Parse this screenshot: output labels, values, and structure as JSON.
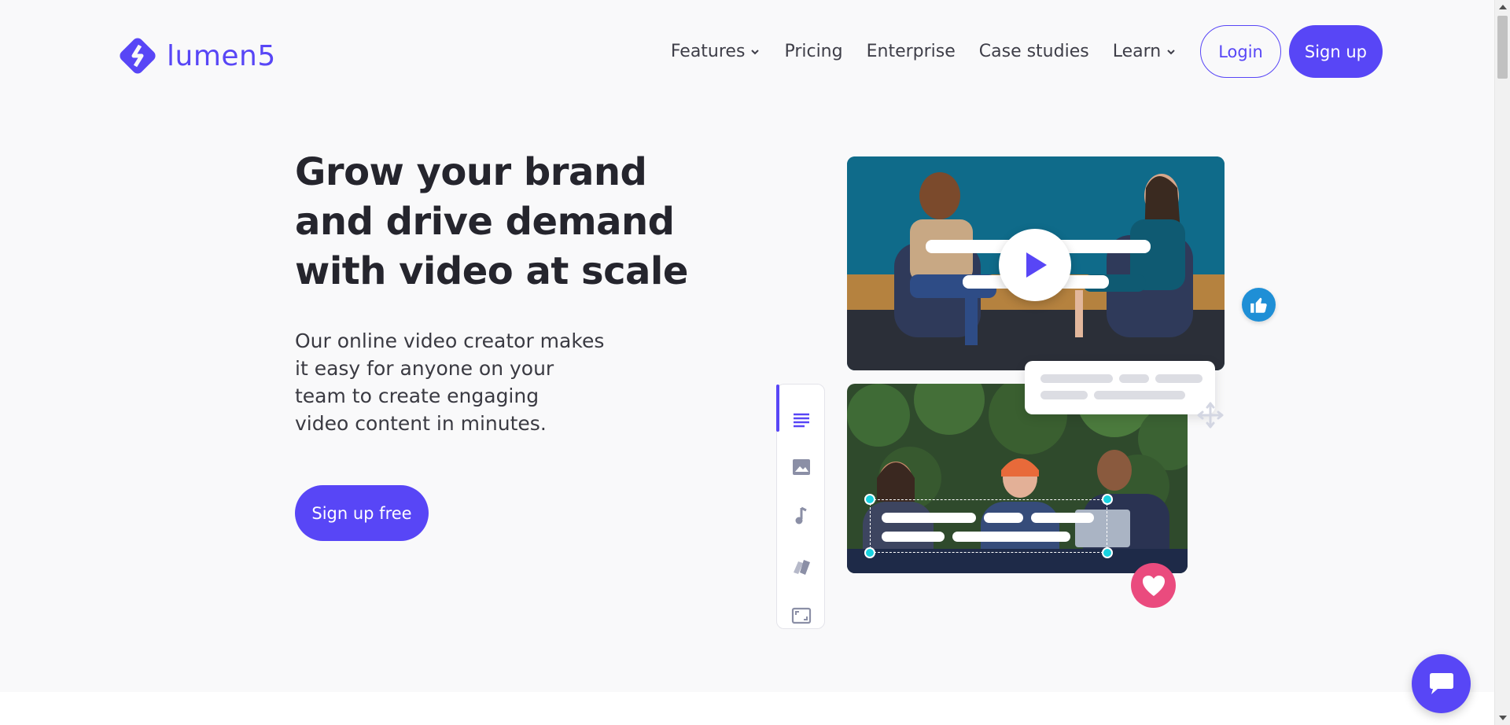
{
  "brand": {
    "name": "lumen5",
    "color": "#5846f6"
  },
  "nav": {
    "items": [
      {
        "label": "Features",
        "has_dropdown": true
      },
      {
        "label": "Pricing",
        "has_dropdown": false
      },
      {
        "label": "Enterprise",
        "has_dropdown": false
      },
      {
        "label": "Case studies",
        "has_dropdown": false
      },
      {
        "label": "Learn",
        "has_dropdown": true
      }
    ],
    "login_label": "Login",
    "signup_label": "Sign up"
  },
  "hero": {
    "title_lines": [
      "Grow your brand",
      "and drive demand",
      "with video at scale"
    ],
    "subtitle_lines": [
      "Our online video creator makes",
      "it easy for anyone on your",
      "team to create engaging",
      "video content in minutes."
    ],
    "cta_label": "Sign up free"
  },
  "illustration": {
    "sidebar_icons": [
      "text-lines-icon",
      "image-icon",
      "music-note-icon",
      "brand-cards-icon",
      "resize-frame-icon"
    ],
    "badges": [
      "thumbs-up-icon",
      "heart-icon",
      "play-icon",
      "move-icon"
    ]
  },
  "colors": {
    "accent": "#5846f6",
    "like_badge": "#1f8fd6",
    "heart_badge": "#ea4b7e",
    "handle": "#19d2e0",
    "background": "#f9f9fa"
  }
}
